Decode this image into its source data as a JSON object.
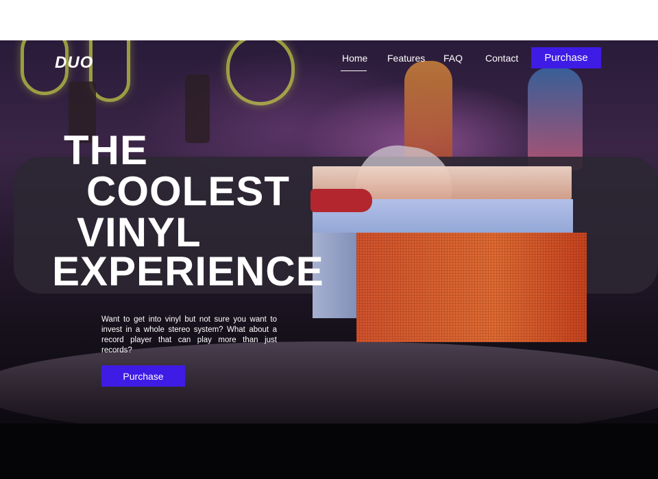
{
  "brand": {
    "logo": "DUO"
  },
  "nav": {
    "items": [
      {
        "label": "Home",
        "active": true
      },
      {
        "label": "Features"
      },
      {
        "label": "FAQ"
      },
      {
        "label": "Contact"
      }
    ],
    "purchase_label": "Purchase"
  },
  "hero": {
    "headline": [
      "THE",
      "COOLEST",
      "VINYL",
      "EXPERIENCE"
    ],
    "description": "Want to get into vinyl but not sure you want to invest in a whole stereo system? What about a record player that can play more than just records?",
    "purchase_label": "Purchase"
  },
  "colors": {
    "accent": "#3f1be6",
    "text": "#ffffff",
    "speaker": "#e06a32"
  }
}
